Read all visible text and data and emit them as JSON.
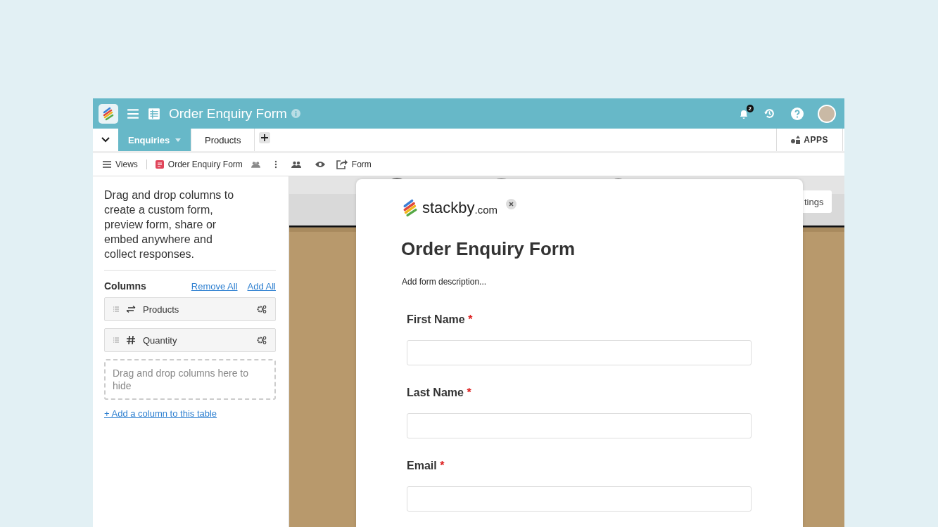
{
  "header": {
    "title": "Order Enquiry Form",
    "notification_count": "2"
  },
  "tabs": [
    {
      "label": "Enquiries",
      "selected": true
    },
    {
      "label": "Products",
      "selected": false
    }
  ],
  "apps_button": "APPS",
  "toolbar": {
    "views": "Views",
    "view_name": "Order Enquiry Form",
    "form_button": "Form"
  },
  "sidebar": {
    "intro": "Drag and drop columns to create a custom form, preview form, share or embed anywhere and collect responses.",
    "columns_heading": "Columns",
    "remove_all": "Remove All",
    "add_all": "Add All",
    "columns": [
      {
        "name": "Products",
        "kind": "link"
      },
      {
        "name": "Quantity",
        "kind": "number"
      }
    ],
    "drop_zone": "Drag and drop columns here to hide",
    "add_column": "+ Add a column to this table"
  },
  "settings_button": "tings",
  "form": {
    "required_mark": "*",
    "logo_name": "stackby",
    "logo_domain": ".com",
    "title": "Order Enquiry Form",
    "description": "Add form description...",
    "fields": [
      {
        "label": "First Name",
        "required": true
      },
      {
        "label": "Last Name",
        "required": true
      },
      {
        "label": "Email",
        "required": true
      }
    ]
  }
}
